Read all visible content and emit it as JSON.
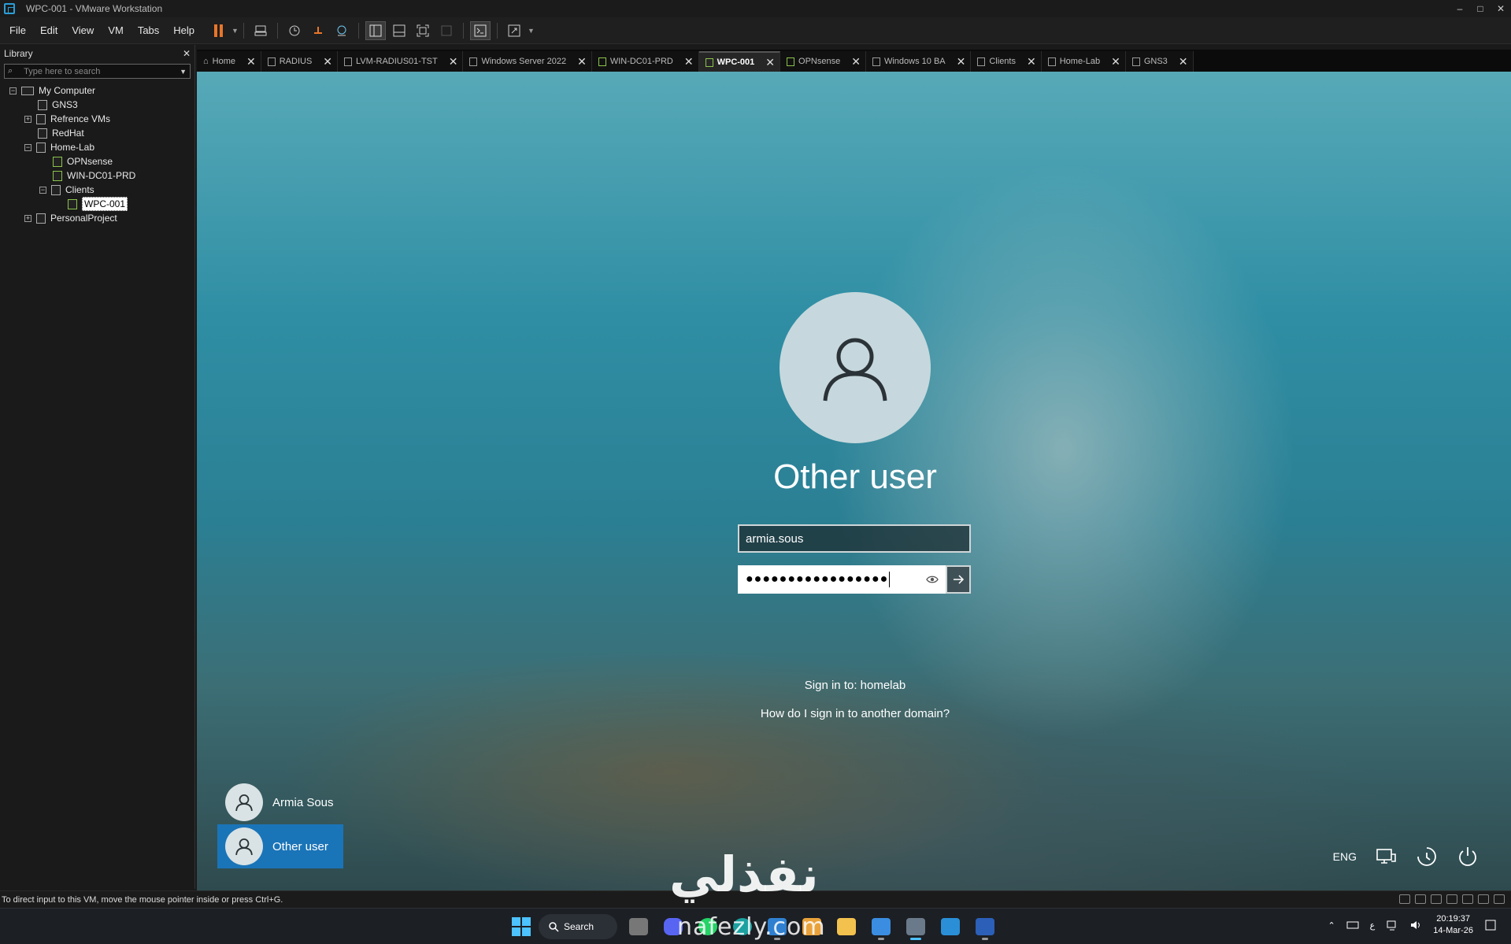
{
  "window": {
    "title": "WPC-001 - VMware Workstation",
    "controls": [
      "–",
      "□",
      "✕"
    ]
  },
  "menu": {
    "file": "File",
    "edit": "Edit",
    "view": "View",
    "vm": "VM",
    "tabs": "Tabs",
    "help": "Help"
  },
  "library": {
    "title": "Library",
    "close": "✕",
    "search_placeholder": "Type here to search",
    "tree": {
      "my_computer": "My Computer",
      "gns3": "GNS3",
      "refrence_vms": "Refrence VMs",
      "redhat": "RedHat",
      "home_lab": "Home-Lab",
      "opnsense": "OPNsense",
      "win_dc01": "WIN-DC01-PRD",
      "clients": "Clients",
      "wpc001": "WPC-001",
      "personal": "PersonalProject"
    }
  },
  "tabs": [
    {
      "label": "Home"
    },
    {
      "label": "RADIUS"
    },
    {
      "label": "LVM-RADIUS01-TST"
    },
    {
      "label": "Windows Server 2022"
    },
    {
      "label": "WIN-DC01-PRD"
    },
    {
      "label": "WPC-001",
      "active": true
    },
    {
      "label": "OPNsense"
    },
    {
      "label": "Windows 10 BA"
    },
    {
      "label": "Clients"
    },
    {
      "label": "Home-Lab"
    },
    {
      "label": "GNS3"
    }
  ],
  "login": {
    "title": "Other user",
    "username_value": "armia.sous",
    "password_mask": "●●●●●●●●●●●●●●●●●",
    "sign_in_to": "Sign in to: homelab",
    "other_domain_link": "How do I sign in to another domain?"
  },
  "users": {
    "armia": "Armia Sous",
    "other": "Other user"
  },
  "lock_controls": {
    "language": "ENG"
  },
  "status_bar": {
    "message": "To direct input to this VM, move the mouse pointer inside or press Ctrl+G."
  },
  "taskbar": {
    "search_label": "Search",
    "watermark": "نفذلي",
    "watermark_sub": "nafezly.com",
    "ime": "ع",
    "time": "20:19:37",
    "date": "14-Mar-26"
  },
  "colors": {
    "selected_user_tile": "#1a74b8",
    "pause_accent": "#e8762b",
    "windows_accent": "#4cc2ff"
  }
}
